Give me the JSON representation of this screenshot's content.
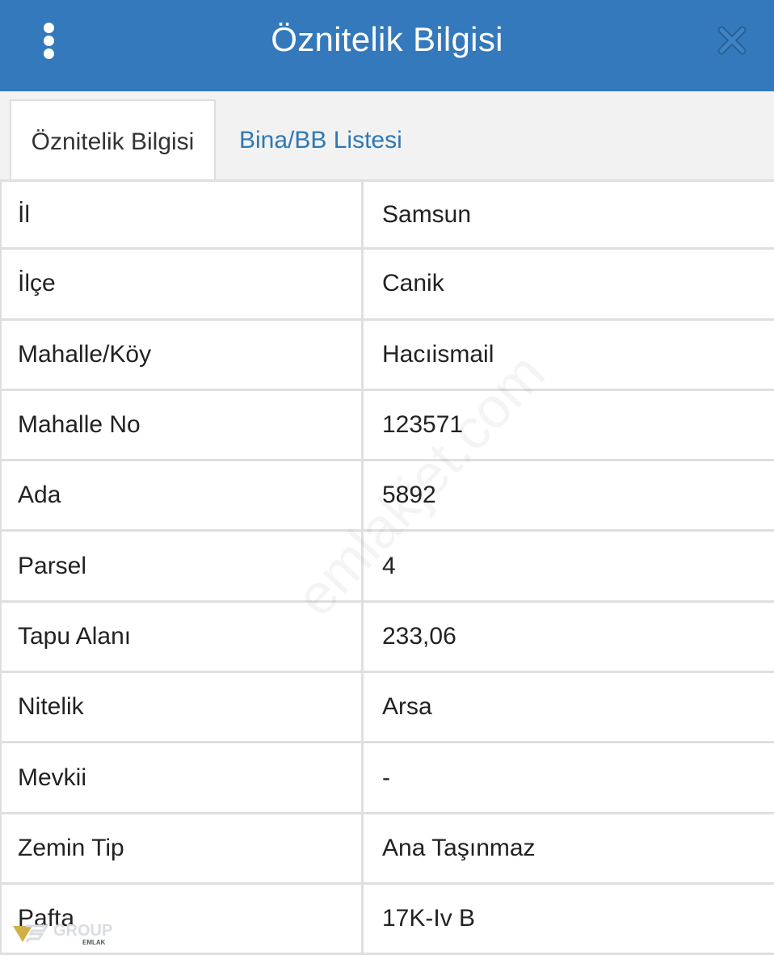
{
  "header": {
    "title": "Öznitelik Bilgisi",
    "menu_icon": "vertical-dots-icon",
    "close_icon": "close-x-icon",
    "background_color": "#3479bb"
  },
  "tabs": [
    {
      "label": "Öznitelik Bilgisi",
      "active": true
    },
    {
      "label": "Bina/BB Listesi",
      "active": false,
      "color": "#2e78b5"
    }
  ],
  "rows": [
    {
      "label": "İl",
      "value": "Samsun"
    },
    {
      "label": "İlçe",
      "value": "Canik"
    },
    {
      "label": "Mahalle/Köy",
      "value": "Hacıismail"
    },
    {
      "label": "Mahalle No",
      "value": "123571"
    },
    {
      "label": "Ada",
      "value": "5892"
    },
    {
      "label": "Parsel",
      "value": "4"
    },
    {
      "label": "Tapu Alanı",
      "value": "233,06"
    },
    {
      "label": "Nitelik",
      "value": "Arsa"
    },
    {
      "label": "Mevkii",
      "value": "-"
    },
    {
      "label": "Zemin Tip",
      "value": "Ana Taşınmaz"
    },
    {
      "label": "Pafta",
      "value": "17K-Iv B"
    }
  ],
  "watermark": "emlakjet.com",
  "logo": {
    "text": "GROUP",
    "subtext": "EMLAK"
  }
}
